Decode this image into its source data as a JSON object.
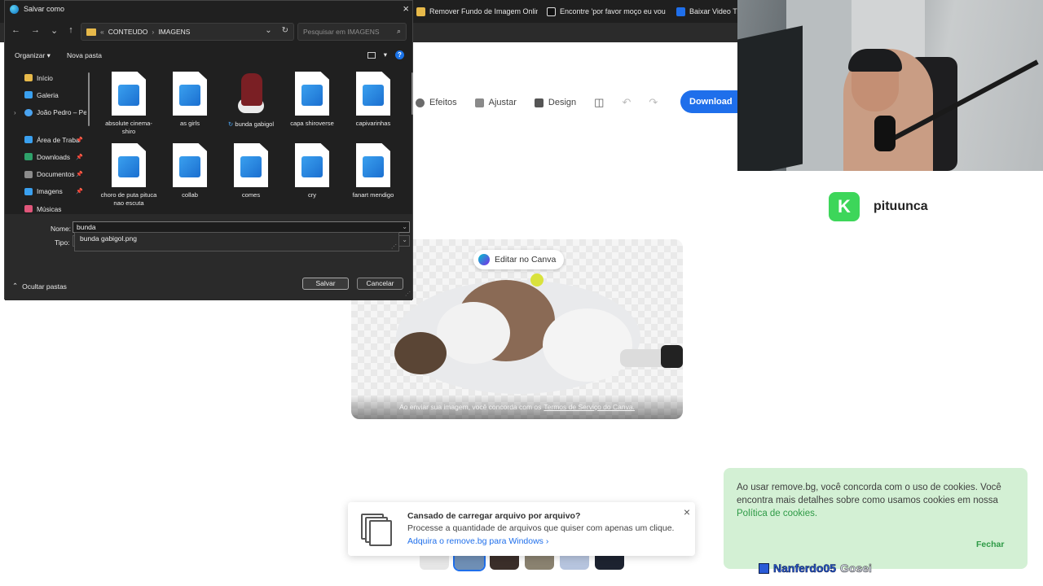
{
  "browser": {
    "tabs": [
      {
        "label": "Remover Fundo de Imagem Online",
        "color": "#e7b94a"
      },
      {
        "label": "Encontre 'por favor moço eu vou m",
        "color": "#111111"
      },
      {
        "label": "Baixar Video TikT",
        "color": "#1f6feb"
      }
    ]
  },
  "editor": {
    "toolbar": {
      "effects": "Efeitos",
      "adjust": "Ajustar",
      "design": "Design"
    },
    "download_label": "Download",
    "edit_canva_label": "Editar no Canva",
    "terms_prefix": "Ao enviar sua imagem, você concorda com os",
    "terms_link": "Termos de Serviço do Canva."
  },
  "upload_banner": {
    "title": "Cansado de carregar arquivo por arquivo?",
    "text": "Processe a quantidade de arquivos que quiser com apenas um clique.",
    "link": "Adquira o remove.bg para Windows",
    "close": "×"
  },
  "brand": {
    "letter": "K",
    "name": "pituunca"
  },
  "cookie": {
    "text": "Ao usar remove.bg, você concorda com o uso de cookies. Você encontra mais detalhes sobre como usamos cookies em nossa",
    "link": "Política de cookies.",
    "close": "Fechar"
  },
  "overlay": {
    "name": "Nanferdo05",
    "second": "Gosei"
  },
  "dialog": {
    "title": "Salvar como",
    "path": [
      "«",
      "CONTEUDO",
      "›",
      "IMAGENS"
    ],
    "search_placeholder": "Pesquisar em IMAGENS",
    "organize": "Organizar ▾",
    "new_folder": "Nova pasta",
    "nav_items": [
      {
        "label": "Início",
        "color": "#e7b94a",
        "pin": false
      },
      {
        "label": "Galeria",
        "color": "#3aa0ef",
        "pin": false
      },
      {
        "label": "João Pedro – Pe",
        "color": "#4aa3f0",
        "pin": false
      },
      {
        "label": "Área de Traba",
        "color": "#3aa0ef",
        "pin": true
      },
      {
        "label": "Downloads",
        "color": "#2ea16a",
        "pin": true
      },
      {
        "label": "Documentos",
        "color": "#8c8c8c",
        "pin": true
      },
      {
        "label": "Imagens",
        "color": "#3aa0ef",
        "pin": true
      },
      {
        "label": "Músicas",
        "color": "#e0567a",
        "pin": true
      }
    ],
    "files": [
      {
        "name": "absolute cinema-shiro",
        "kind": "doc"
      },
      {
        "name": "as girls",
        "kind": "doc"
      },
      {
        "name": "bunda gabigol",
        "kind": "photo"
      },
      {
        "name": "capa shiroverse",
        "kind": "doc"
      },
      {
        "name": "capivarinhas",
        "kind": "doc"
      },
      {
        "name": "choro de puta pituca nao escuta",
        "kind": "doc"
      },
      {
        "name": "collab",
        "kind": "doc"
      },
      {
        "name": "comes",
        "kind": "doc"
      },
      {
        "name": "cry",
        "kind": "doc"
      },
      {
        "name": "fanart mendigo",
        "kind": "doc"
      }
    ],
    "name_label": "Nome:",
    "type_label": "Tipo:",
    "name_value": "bunda",
    "suggestion": "bunda gabigol.png",
    "hide_folders": "Ocultar pastas",
    "save": "Salvar",
    "cancel": "Cancelar"
  }
}
